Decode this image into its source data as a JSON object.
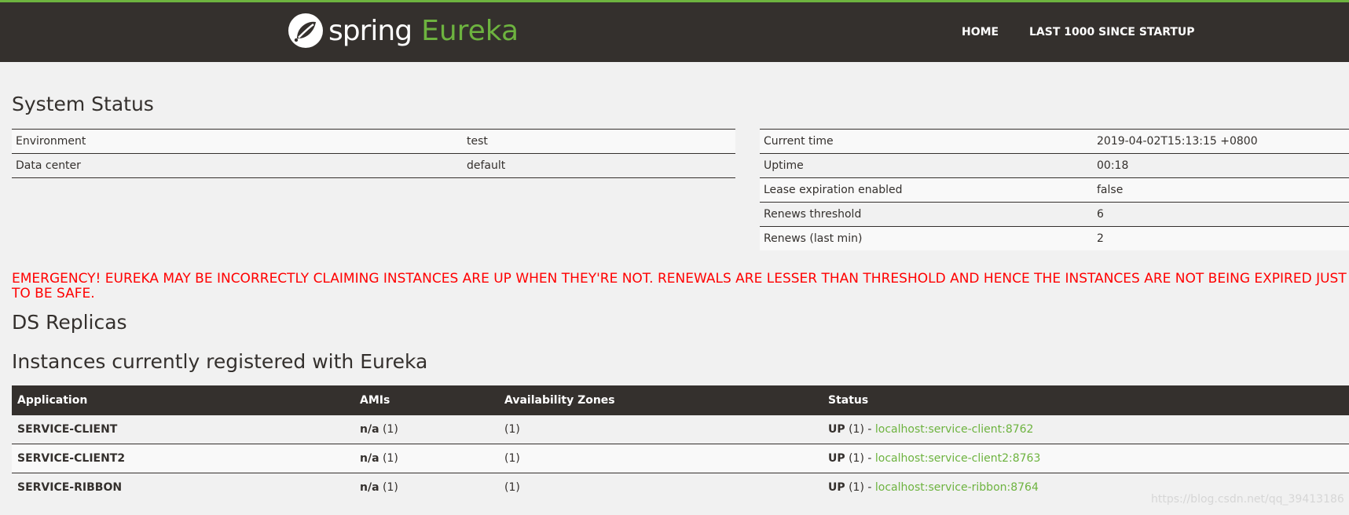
{
  "header": {
    "brand_spring": "spring",
    "brand_eureka": "Eureka",
    "nav": [
      "HOME",
      "LAST 1000 SINCE STARTUP"
    ],
    "colors": {
      "bar": "#34302d",
      "accent": "#6db33f"
    }
  },
  "system_status": {
    "title": "System Status",
    "left": [
      {
        "label": "Environment",
        "value": "test"
      },
      {
        "label": "Data center",
        "value": "default"
      }
    ],
    "right": [
      {
        "label": "Current time",
        "value": "2019-04-02T15:13:15 +0800"
      },
      {
        "label": "Uptime",
        "value": "00:18"
      },
      {
        "label": "Lease expiration enabled",
        "value": "false"
      },
      {
        "label": "Renews threshold",
        "value": "6"
      },
      {
        "label": "Renews (last min)",
        "value": "2"
      }
    ]
  },
  "emergency": "EMERGENCY! EUREKA MAY BE INCORRECTLY CLAIMING INSTANCES ARE UP WHEN THEY'RE NOT. RENEWALS ARE LESSER THAN THRESHOLD AND HENCE THE INSTANCES ARE NOT BEING EXPIRED JUST TO BE SAFE.",
  "ds_replicas": {
    "title": "DS Replicas"
  },
  "instances": {
    "title": "Instances currently registered with Eureka",
    "headers": [
      "Application",
      "AMIs",
      "Availability Zones",
      "Status"
    ],
    "rows": [
      {
        "app": "SERVICE-CLIENT",
        "ami": "n/a",
        "ami_count": "(1)",
        "zones": "(1)",
        "status": "UP",
        "status_count": "(1) -",
        "link": "localhost:service-client:8762"
      },
      {
        "app": "SERVICE-CLIENT2",
        "ami": "n/a",
        "ami_count": "(1)",
        "zones": "(1)",
        "status": "UP",
        "status_count": "(1) -",
        "link": "localhost:service-client2:8763"
      },
      {
        "app": "SERVICE-RIBBON",
        "ami": "n/a",
        "ami_count": "(1)",
        "zones": "(1)",
        "status": "UP",
        "status_count": "(1) -",
        "link": "localhost:service-ribbon:8764"
      }
    ]
  },
  "watermark": "https://blog.csdn.net/qq_39413186"
}
